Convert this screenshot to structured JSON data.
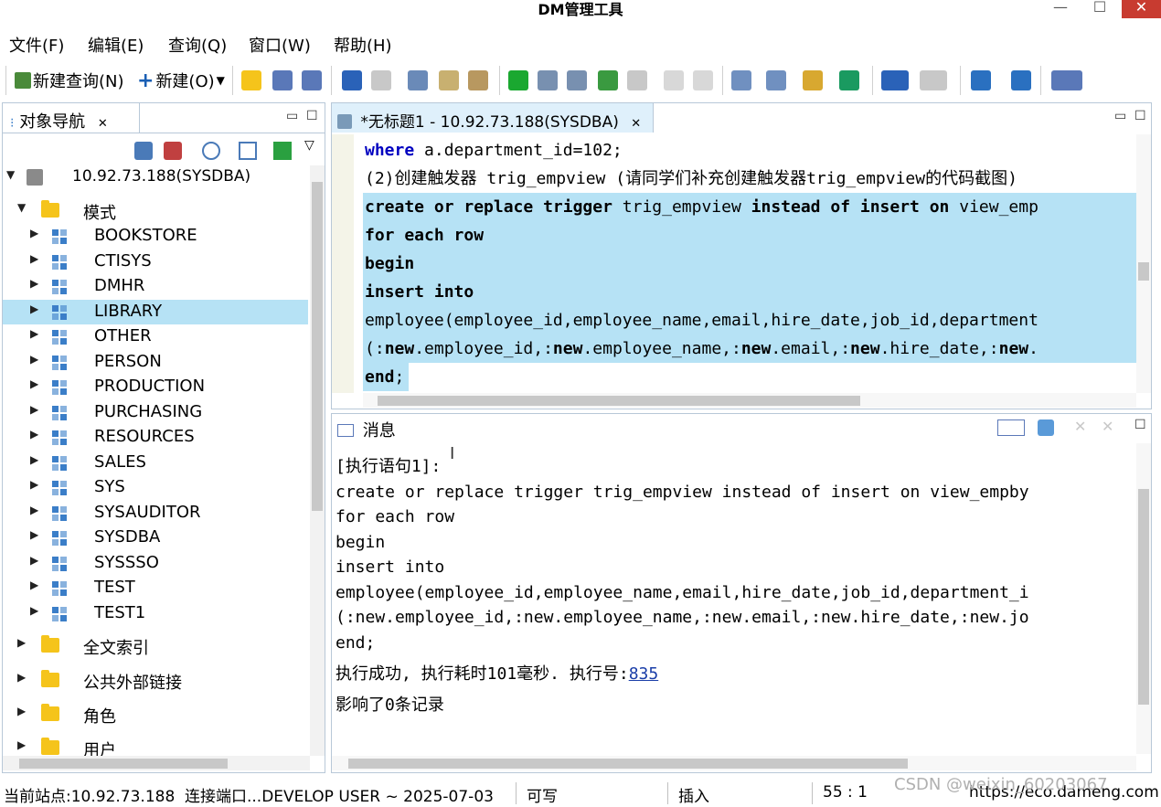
{
  "window": {
    "title": "DM管理工具",
    "min_glyph": "—",
    "max_glyph": "☐",
    "close_glyph": "✕"
  },
  "menu": [
    "文件(F)",
    "编辑(E)",
    "查询(Q)",
    "窗口(W)",
    "帮助(H)"
  ],
  "toolbar": {
    "new_query_label": "新建查询(N)",
    "new_label": "新建(O)"
  },
  "navigator": {
    "tab_label": "对象导航",
    "tab_close": "✕",
    "server": "10.92.73.188(SYSDBA)",
    "schema_folder": "模式",
    "schemas": [
      "BOOKSTORE",
      "CTISYS",
      "DMHR",
      "LIBRARY",
      "OTHER",
      "PERSON",
      "PRODUCTION",
      "PURCHASING",
      "RESOURCES",
      "SALES",
      "SYS",
      "SYSAUDITOR",
      "SYSDBA",
      "SYSSSO",
      "TEST",
      "TEST1"
    ],
    "selected_schema": "LIBRARY",
    "folders": [
      "全文索引",
      "公共外部链接",
      "角色",
      "用户"
    ]
  },
  "editor": {
    "tab_label": "*无标题1 - 10.92.73.188(SYSDBA)",
    "tab_close": "✕",
    "lines": [
      {
        "kw": "where",
        "rest": " a.department_id=102;"
      },
      {
        "text": "(2)创建触发器 trig_empview (请同学们补充创建触发器trig_empview的代码截图)"
      },
      {
        "kw1": "create or replace trigger",
        "mid": " trig_empview ",
        "kw2": "instead of insert on",
        "rest": " view_emp"
      },
      {
        "kw": "for each row"
      },
      {
        "kw": "begin"
      },
      {
        "kw": "insert into"
      },
      {
        "text": "employee(employee_id,employee_name,email,hire_date,job_id,department"
      },
      {
        "p1": "(:",
        "n1": "new",
        "p2": ".employee_id,:",
        "n2": "new",
        "p3": ".employee_name,:",
        "n3": "new",
        "p4": ".email,:",
        "n4": "new",
        "p5": ".hire_date,:",
        "n5": "new",
        "p6": "."
      },
      {
        "kw": "end",
        "rest": ";"
      }
    ]
  },
  "messages": {
    "tab_label": "消息",
    "lines": [
      "[执行语句1]:",
      "create or replace trigger trig_empview instead of insert on view_empby",
      "for each row",
      "begin",
      "insert into",
      "employee(employee_id,employee_name,email,hire_date,job_id,department_i",
      "(:new.employee_id,:new.employee_name,:new.email,:new.hire_date,:new.jo",
      "end;"
    ],
    "success_prefix": "执行成功, 执行耗时101毫秒. 执行号:",
    "exec_number": "835",
    "affected": "影响了0条记录"
  },
  "status": {
    "site": "当前站点:10.92.73.188",
    "connection": "连接端口...DEVELOP USER ~ 2025-07-03",
    "writable": "可写",
    "insert_mode": "插入",
    "cursor_pos": "55 : 1",
    "url": "https://eco.dameng.com"
  },
  "watermark": "CSDN @weixin_60203067",
  "colors": {
    "selection": "#b6e2f5",
    "keyword": "#0000c0",
    "schema_icon": "#3b7ec8",
    "folder": "#f5c41b",
    "close_button": "#c83b30"
  }
}
